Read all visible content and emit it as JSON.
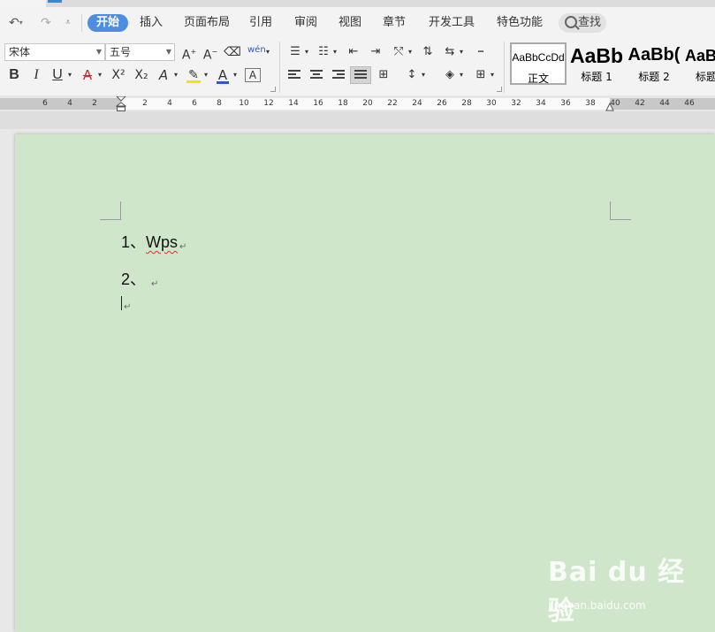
{
  "menu": {
    "items": [
      "开始",
      "插入",
      "页面布局",
      "引用",
      "审阅",
      "视图",
      "章节",
      "开发工具",
      "特色功能"
    ],
    "active": "开始",
    "search_label": "查找"
  },
  "toolbar": {
    "font_name": "宋体",
    "font_size": "五号",
    "bold": "B",
    "italic": "I",
    "underline": "U",
    "superscript": "X²",
    "subscript": "X₂",
    "pinyin": "wén"
  },
  "styles": [
    {
      "preview": "AaBbCcDd",
      "name": "正文"
    },
    {
      "preview": "AaBb",
      "name": "标题 1"
    },
    {
      "preview": "AaBb(",
      "name": "标题 2"
    },
    {
      "preview": "AaBb",
      "name": "标题"
    }
  ],
  "ruler": {
    "left_numbers": [
      "6",
      "4",
      "2"
    ],
    "right_numbers": [
      "2",
      "4",
      "6",
      "8",
      "10",
      "12",
      "14",
      "16",
      "18",
      "20",
      "22",
      "24",
      "26",
      "28",
      "30",
      "32",
      "34",
      "36",
      "38",
      "40",
      "42",
      "44",
      "46"
    ]
  },
  "document": {
    "line1_number": "1、",
    "line1_text": "Wps",
    "line2_number": "2、",
    "pilcrow": "↵"
  },
  "watermark": {
    "logo": "Bai du 经验",
    "url": "jingyan.baidu.com"
  },
  "colors": {
    "page_background": "#cfe6cb",
    "accent": "#4d8ee0",
    "highlight": "#f2e600",
    "font_color": "#2a5bd7",
    "spell_error": "#e03030"
  }
}
